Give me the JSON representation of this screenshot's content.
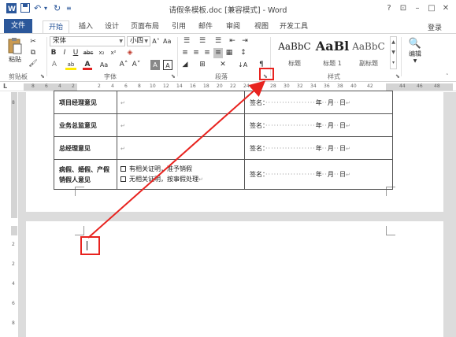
{
  "titlebar": {
    "title": "请假条模板.doc [兼容模式] - Word",
    "help": "?",
    "ribbon_display": "⊡",
    "minimize": "–",
    "maximize": "□",
    "close": "✕"
  },
  "tabs": {
    "file": "文件",
    "items": [
      "开始",
      "插入",
      "设计",
      "页面布局",
      "引用",
      "邮件",
      "审阅",
      "视图",
      "开发工具"
    ],
    "login": "登录"
  },
  "ribbon": {
    "paste_label": "粘贴",
    "font_name": "宋体",
    "font_size": "小四",
    "styles": [
      {
        "sample": "AaBbC",
        "name": "标题"
      },
      {
        "sample": "AaBl",
        "name": "标题 1"
      },
      {
        "sample": "AaBbC",
        "name": "副标题"
      }
    ],
    "edit_label": "编辑",
    "groups": {
      "clipboard": "剪贴板",
      "font": "字体",
      "paragraph": "段落",
      "styles": "样式"
    }
  },
  "ruler": {
    "ticks": [
      "L",
      "8",
      "6",
      "4",
      "2",
      "2",
      "4",
      "6",
      "8",
      "10",
      "12",
      "14",
      "16",
      "18",
      "20",
      "22",
      "24",
      "26",
      "28",
      "30",
      "32",
      "34",
      "36",
      "38",
      "40",
      "42",
      "44",
      "46",
      "48"
    ]
  },
  "table": {
    "rows": [
      {
        "label": "项目经理意见",
        "sign": "签名：",
        "year": "年",
        "month": "月",
        "day": "日"
      },
      {
        "label": "业务总监意见",
        "sign": "签名：",
        "year": "年",
        "month": "月",
        "day": "日"
      },
      {
        "label": "总经理意见",
        "sign": "签名：",
        "year": "年",
        "month": "月",
        "day": "日"
      },
      {
        "label": "病假、婚假、产假销假人意见",
        "option1": "有相关证明，准予销假",
        "option2": "无相关证明，按事假处理",
        "sign": "签名：",
        "year": "年",
        "month": "月",
        "day": "日"
      }
    ]
  },
  "colors": {
    "accent": "#2b579a",
    "annotation": "#e8231f"
  }
}
